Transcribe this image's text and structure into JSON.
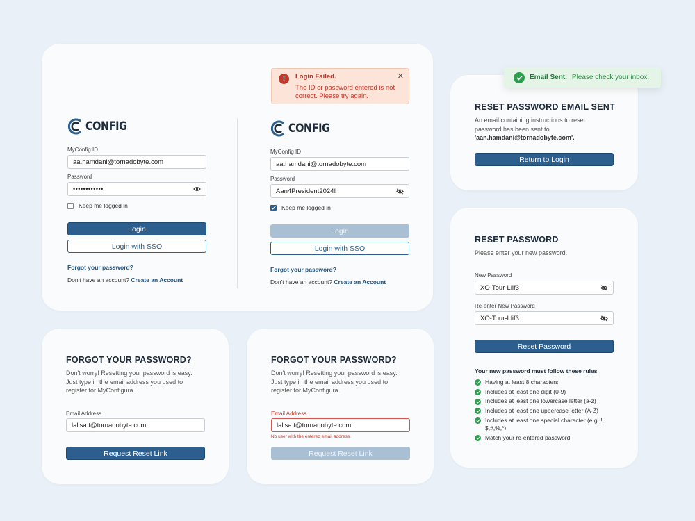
{
  "logo": {
    "text": "CONFIG"
  },
  "login_panel_a": {
    "id_label": "MyConfig ID",
    "id_value": "aa.hamdani@tornadobyte.com",
    "password_label": "Password",
    "password_value": "••••••••••••",
    "keep_logged_in": "Keep me logged in",
    "login_button": "Login",
    "sso_button": "Login with SSO",
    "forgot_link": "Forgot your password?",
    "no_account": "Don't have an account?",
    "create_link": "Create an Account"
  },
  "login_panel_b": {
    "alert": {
      "title": "Login Failed.",
      "message": "The ID or password entered is not correct. Please try again.",
      "close": "✕"
    },
    "id_label": "MyConfig ID",
    "id_value": "aa.hamdani@tornadobyte.com",
    "password_label": "Password",
    "password_value": "Aan4President2024!",
    "keep_logged_in": "Keep me logged in",
    "login_button": "Login",
    "sso_button": "Login with SSO",
    "forgot_link": "Forgot your password?",
    "no_account": "Don't have an account?",
    "create_link": "Create an Account"
  },
  "forgot_a": {
    "heading": "FORGOT YOUR PASSWORD?",
    "description": "Don't worry! Resetting your password is easy. Just type in the email address you used to register for MyConfigura.",
    "email_label": "Email Address",
    "email_value": "lalisa.t@tornadobyte.com",
    "button": "Request Reset Link"
  },
  "forgot_b": {
    "heading": "FORGOT YOUR PASSWORD?",
    "description": "Don't worry! Resetting your password is easy. Just type in the email address you used to register for MyConfigura.",
    "email_label": "Email Address",
    "email_value": "lalisa.t@tornadobyte.com",
    "error": "No user with the entered email address.",
    "button": "Request Reset Link"
  },
  "toast": {
    "title": "Email Sent.",
    "message": "Please check your inbox."
  },
  "email_sent": {
    "heading": "RESET PASSWORD EMAIL SENT",
    "description": "An email containing instructions to reset password has been sent to",
    "email": "'aan.hamdani@tornadobyte.com'.",
    "button": "Return to Login"
  },
  "reset": {
    "heading": "RESET PASSWORD",
    "description": "Please enter your new password.",
    "new_label": "New Password",
    "new_value": "XO-Tour-Llif3",
    "reenter_label": "Re-enter New Password",
    "reenter_value": "XO-Tour-Llif3",
    "button": "Reset Password",
    "rules_title": "Your new password must follow these rules",
    "rules": [
      "Having at least 8 characters",
      "Includes at least one digit (0-9)",
      "Includes at least one lowercase letter (a-z)",
      "Includes at least one uppercase letter (A-Z)",
      "Includes at least one special character (e.g. !, $,#,%,*)",
      "Match your re-entered password"
    ]
  },
  "colors": {
    "background": "#e9f0f7",
    "primary": "#2c5f8d",
    "disabled": "#a9bfd3",
    "error": "#c0392b",
    "success": "#2e9e4f"
  }
}
